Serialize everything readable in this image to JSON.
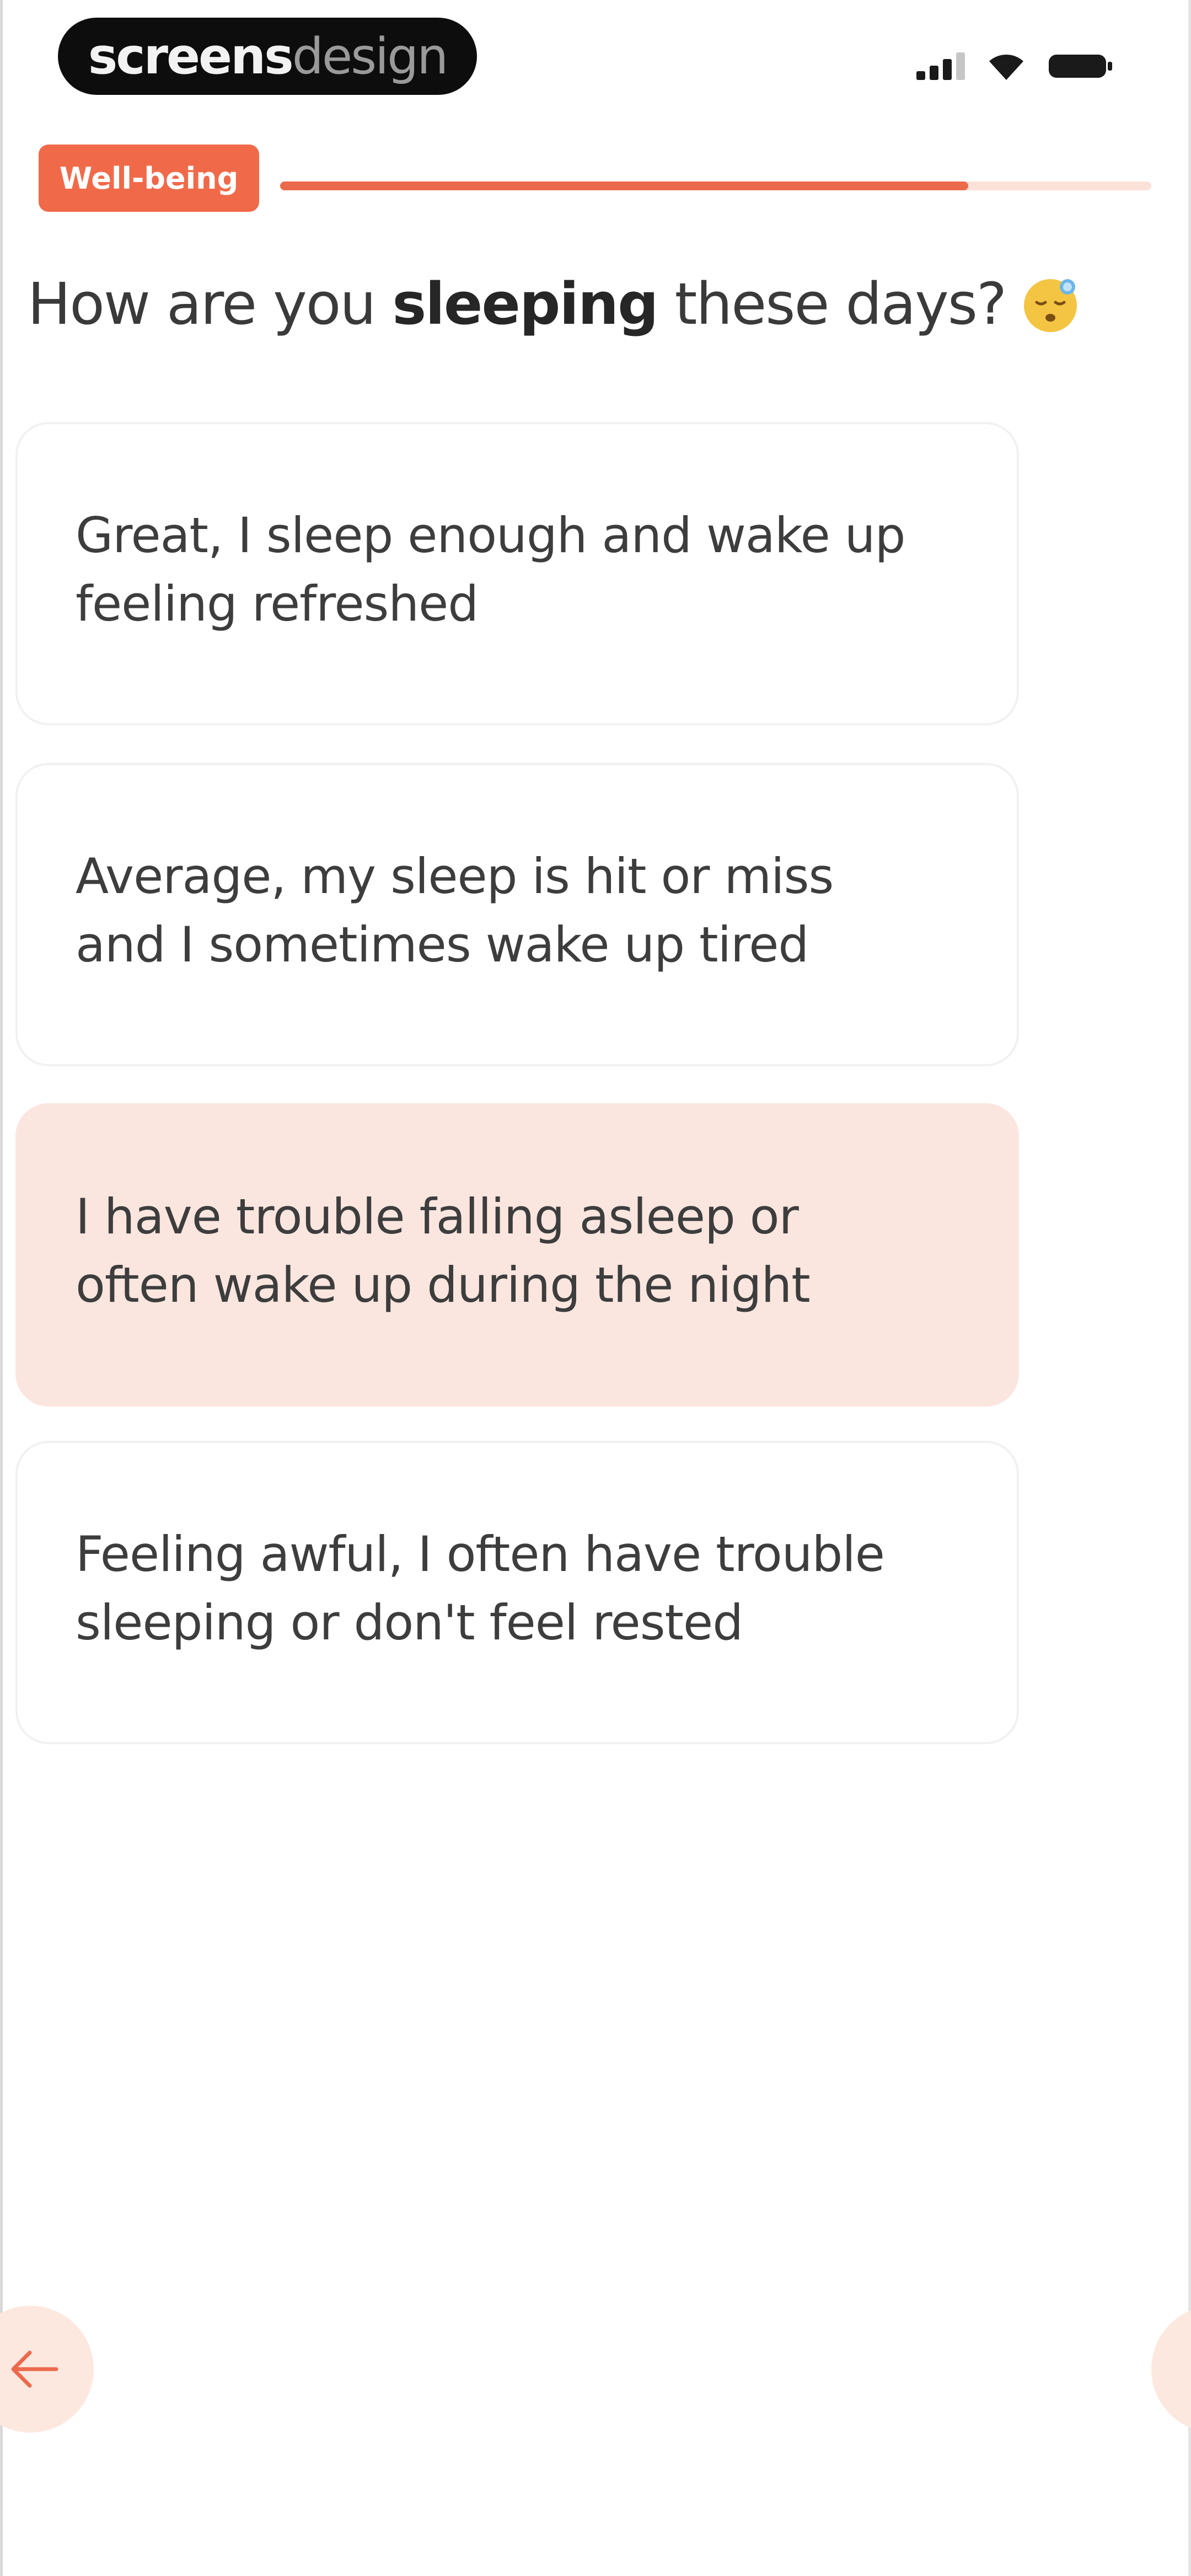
{
  "status_bar": {
    "watermark_bold": "screens",
    "watermark_light": "design"
  },
  "progress": {
    "category": "Well-being",
    "fraction": 0.79
  },
  "question": {
    "prefix": "How are you ",
    "emphasis": "sleeping",
    "suffix": " these days?",
    "emoji_icon": "sleepy-face-icon"
  },
  "options": [
    {
      "line1": "Great, I sleep enough and wake up",
      "line2": "feeling refreshed",
      "selected": false
    },
    {
      "line1": "Average, my sleep is hit or miss",
      "line2": "and I sometimes wake up tired",
      "selected": false
    },
    {
      "line1": "I have trouble falling asleep or",
      "line2": "often wake up during the night",
      "selected": true
    },
    {
      "line1": "Feeling awful, I often have trouble",
      "line2": "sleeping or don't feel rested",
      "selected": false
    }
  ],
  "navigation": {
    "back_icon": "arrow-left-icon",
    "next_icon": "arrow-right-icon"
  },
  "colors": {
    "accent": "#ec6a4c",
    "accent_light": "#fbe6df",
    "text": "#3d3d3d"
  }
}
